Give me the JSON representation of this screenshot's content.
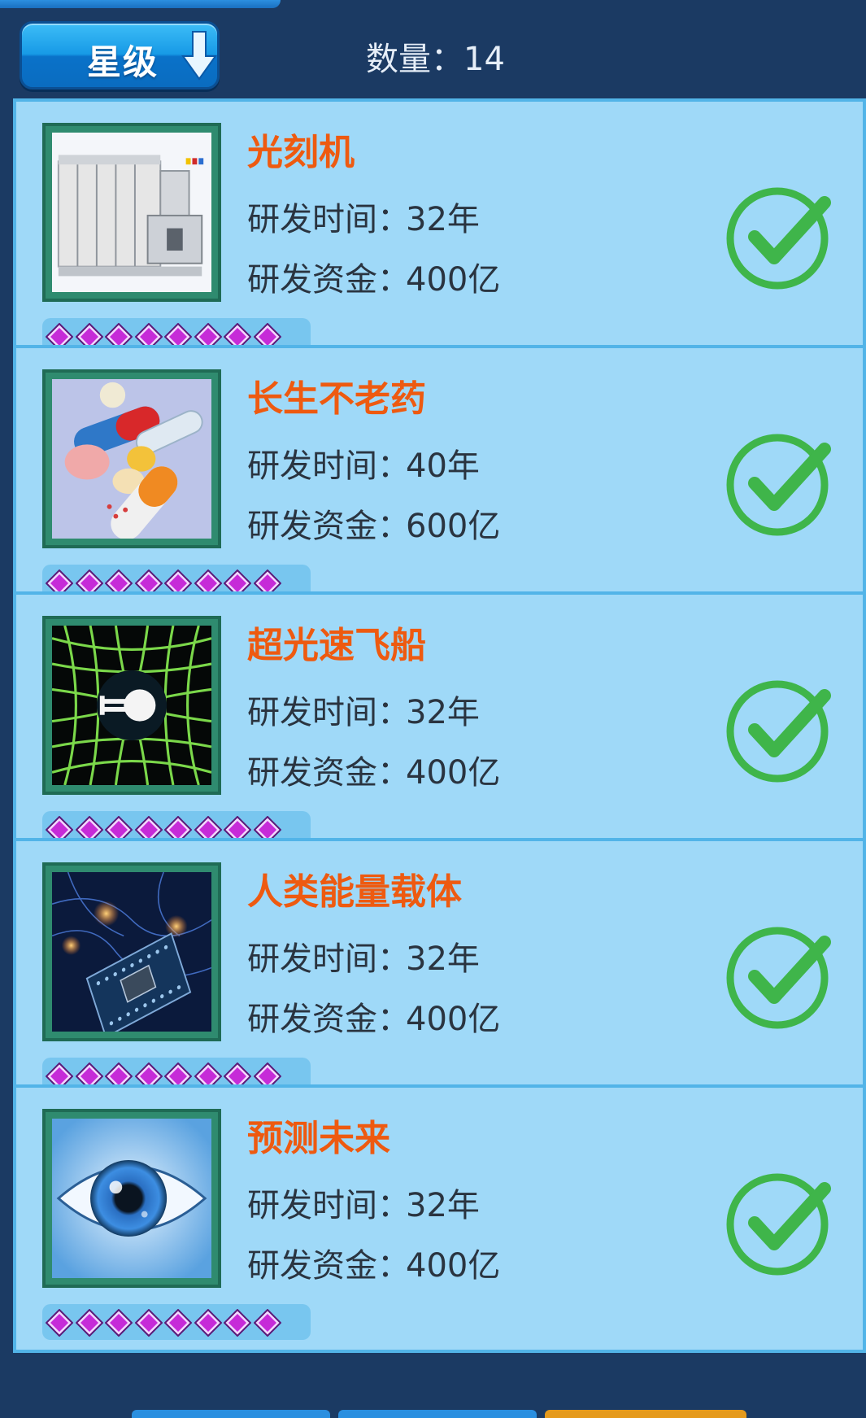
{
  "header": {
    "sort_label": "星级",
    "sort_icon": "arrow-down-icon",
    "count_label": "数量：",
    "count_value": "14"
  },
  "colors": {
    "card_bg": "#9fd9f8",
    "name_color": "#ee5a10",
    "check_color": "#3fb54a",
    "star_color": "#c62bd8"
  },
  "items": [
    {
      "name": "光刻机",
      "image": "lithography-machine-image",
      "time_label": "研发时间：",
      "time_value": "32年",
      "fund_label": "研发资金：",
      "fund_value": "400亿",
      "stars": 8,
      "status_icon": "check-circle-icon"
    },
    {
      "name": "长生不老药",
      "image": "pills-image",
      "time_label": "研发时间：",
      "time_value": "40年",
      "fund_label": "研发资金：",
      "fund_value": "600亿",
      "stars": 8,
      "status_icon": "check-circle-icon"
    },
    {
      "name": "超光速飞船",
      "image": "warp-ship-image",
      "time_label": "研发时间：",
      "time_value": "32年",
      "fund_label": "研发资金：",
      "fund_value": "400亿",
      "stars": 8,
      "status_icon": "check-circle-icon"
    },
    {
      "name": "人类能量载体",
      "image": "chip-image",
      "time_label": "研发时间：",
      "time_value": "32年",
      "fund_label": "研发资金：",
      "fund_value": "400亿",
      "stars": 8,
      "status_icon": "check-circle-icon"
    },
    {
      "name": "预测未来",
      "image": "eye-image",
      "time_label": "研发时间：",
      "time_value": "32年",
      "fund_label": "研发资金：",
      "fund_value": "400亿",
      "stars": 8,
      "status_icon": "check-circle-icon"
    }
  ]
}
